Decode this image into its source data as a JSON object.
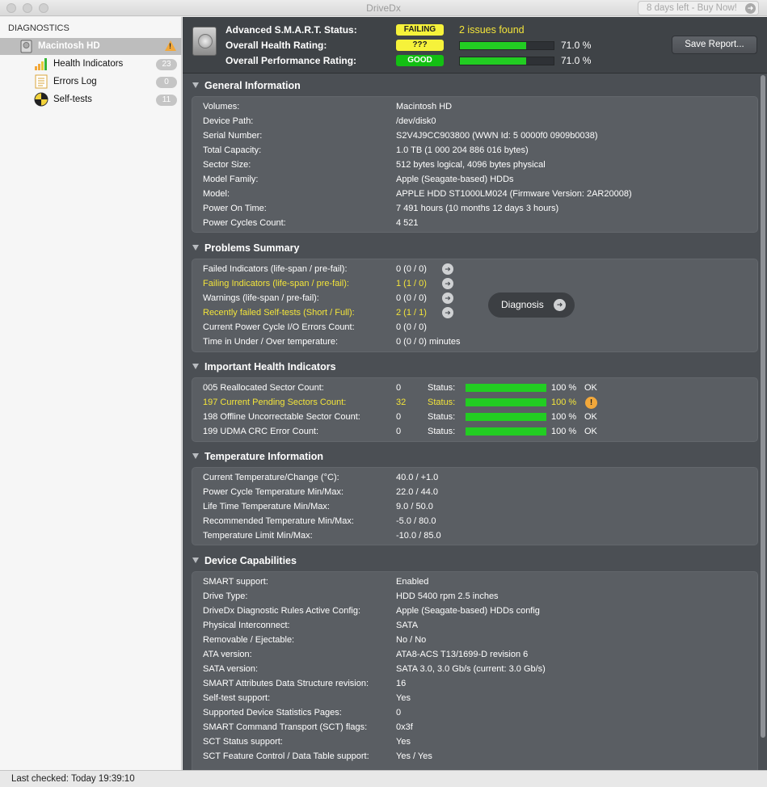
{
  "window": {
    "title": "DriveDx",
    "buy_label": "8 days left - Buy Now!"
  },
  "sidebar": {
    "header": "DIAGNOSTICS",
    "drive": {
      "label": "Macintosh HD"
    },
    "items": [
      {
        "label": "Health Indicators",
        "badge": "23"
      },
      {
        "label": "Errors Log",
        "badge": "0"
      },
      {
        "label": "Self-tests",
        "badge": "11"
      }
    ]
  },
  "summary": {
    "smart_label": "Advanced S.M.A.R.T. Status:",
    "smart_value": "FAILING",
    "issues": "2 issues found",
    "health_label": "Overall Health Rating:",
    "health_value": "???",
    "health_pct": "71.0 %",
    "health_fill": 0.71,
    "perf_label": "Overall Performance Rating:",
    "perf_value": "GOOD",
    "perf_pct": "71.0 %",
    "perf_fill": 0.71,
    "save_label": "Save Report..."
  },
  "general": {
    "title": "General Information",
    "rows": [
      {
        "k": "Volumes:",
        "v": "Macintosh HD"
      },
      {
        "k": "Device Path:",
        "v": "/dev/disk0"
      },
      {
        "k": "Serial Number:",
        "v": "S2V4J9CC903800 (WWN Id: 5 0000f0 0909b0038)"
      },
      {
        "k": "Total Capacity:",
        "v": "1.0 TB (1 000 204 886 016 bytes)"
      },
      {
        "k": "Sector Size:",
        "v": "512 bytes logical, 4096 bytes physical"
      },
      {
        "k": "Model Family:",
        "v": "Apple (Seagate-based) HDDs"
      },
      {
        "k": "Model:",
        "v": "APPLE HDD ST1000LM024  (Firmware Version: 2AR20008)"
      },
      {
        "k": "Power On Time:",
        "v": "7 491 hours (10 months 12 days 3 hours)"
      },
      {
        "k": "Power Cycles Count:",
        "v": "4 521"
      }
    ]
  },
  "problems": {
    "title": "Problems Summary",
    "rows": [
      {
        "k": "Failed Indicators (life-span / pre-fail):",
        "v": "0 (0 / 0)"
      },
      {
        "k": "Failing Indicators (life-span / pre-fail):",
        "v": "1 (1 / 0)"
      },
      {
        "k": "Warnings (life-span / pre-fail):",
        "v": "0 (0 / 0)"
      },
      {
        "k": "Recently failed Self-tests (Short / Full):",
        "v": "2 (1 / 1)"
      },
      {
        "k": "Current Power Cycle I/O Errors Count:",
        "v": "0 (0 / 0)"
      },
      {
        "k": "Time in Under / Over temperature:",
        "v": "0 (0 / 0)  minutes"
      }
    ],
    "diagnosis_label": "Diagnosis"
  },
  "health": {
    "title": "Important Health Indicators",
    "status_label": "Status:",
    "rows": [
      {
        "k": "005  Reallocated Sector Count:",
        "v": "0",
        "pct": "100 %",
        "fill": 1.0,
        "ok": "OK"
      },
      {
        "k": "197  Current Pending Sectors Count:",
        "v": "32",
        "pct": "100 %",
        "fill": 1.0,
        "ok": "!"
      },
      {
        "k": "198  Offline Uncorrectable Sector Count:",
        "v": "0",
        "pct": "100 %",
        "fill": 1.0,
        "ok": "OK"
      },
      {
        "k": "199  UDMA CRC Error Count:",
        "v": "0",
        "pct": "100 %",
        "fill": 1.0,
        "ok": "OK"
      }
    ]
  },
  "temperature": {
    "title": "Temperature Information",
    "rows": [
      {
        "k": "Current Temperature/Change (°C):",
        "v": "40.0   / +1.0"
      },
      {
        "k": "Power Cycle Temperature Min/Max:",
        "v": "22.0   / 44.0"
      },
      {
        "k": "Life Time Temperature Min/Max:",
        "v": "9.0     / 50.0"
      },
      {
        "k": "Recommended Temperature Min/Max:",
        "v": "-5.0   / 80.0"
      },
      {
        "k": "Temperature Limit Min/Max:",
        "v": "-10.0 / 85.0"
      }
    ]
  },
  "capabilities": {
    "title": "Device Capabilities",
    "rows": [
      {
        "k": "SMART support:",
        "v": "Enabled"
      },
      {
        "k": "Drive Type:",
        "v": "HDD 5400 rpm 2.5 inches"
      },
      {
        "k": "DriveDx Diagnostic Rules Active Config:",
        "v": "Apple (Seagate-based) HDDs config"
      },
      {
        "k": "Physical Interconnect:",
        "v": "SATA"
      },
      {
        "k": "Removable / Ejectable:",
        "v": "No / No"
      },
      {
        "k": "ATA version:",
        "v": "ATA8-ACS T13/1699-D revision 6"
      },
      {
        "k": "SATA version:",
        "v": "SATA 3.0, 3.0 Gb/s (current: 3.0 Gb/s)"
      },
      {
        "k": "SMART Attributes Data Structure revision:",
        "v": "16"
      },
      {
        "k": "Self-test support:",
        "v": "Yes"
      },
      {
        "k": "Supported Device Statistics Pages:",
        "v": "0"
      },
      {
        "k": "SMART Command Transport (SCT) flags:",
        "v": "0x3f"
      },
      {
        "k": "SCT Status support:",
        "v": "Yes"
      },
      {
        "k": "SCT Feature Control / Data Table support:",
        "v": "Yes / Yes"
      }
    ]
  },
  "statusbar": {
    "text": "Last checked: Today 19:39:10"
  }
}
